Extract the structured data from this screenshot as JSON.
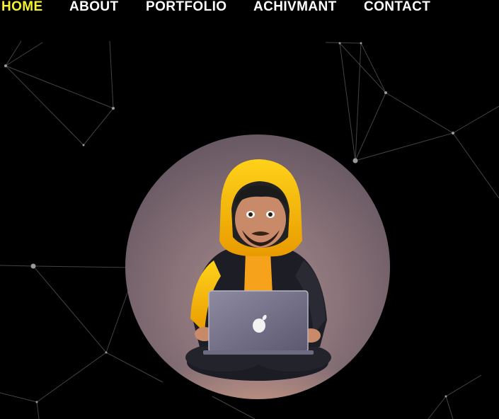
{
  "nav": {
    "items": [
      {
        "label": "HOME",
        "active": true
      },
      {
        "label": "ABOUT",
        "active": false
      },
      {
        "label": "PORTFOLIO",
        "active": false
      },
      {
        "label": "ACHIVMANT",
        "active": false
      },
      {
        "label": "CONTACT",
        "active": false
      }
    ]
  },
  "hero": {
    "image": "developer-with-laptop-avatar"
  },
  "colors": {
    "background": "#000000",
    "nav_active": "#f5f32a",
    "nav_text": "#ffffff",
    "hoodie": "#f4b400"
  }
}
